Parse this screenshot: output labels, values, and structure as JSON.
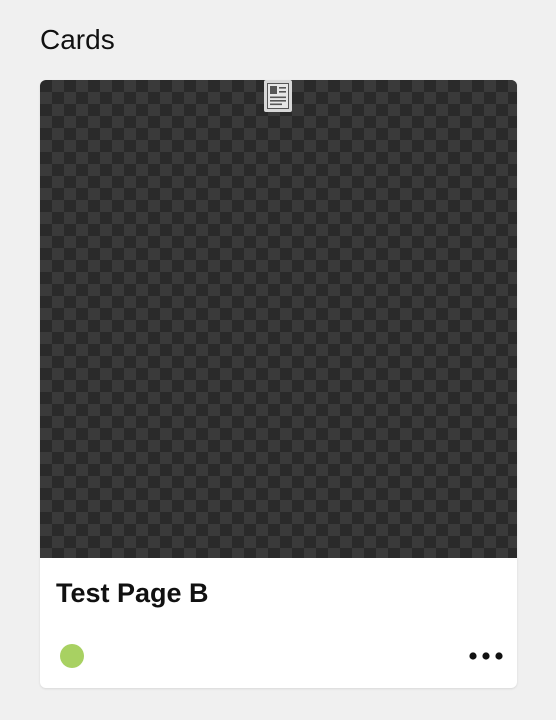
{
  "section": {
    "title": "Cards"
  },
  "card": {
    "title": "Test Page B",
    "preview_icon": "document-page-icon",
    "status_icon": "status-dot-icon",
    "status_color": "#a8d162",
    "menu_icon": "more-horizontal-icon"
  },
  "colors": {
    "background": "#f0f0f0",
    "card": "#ffffff",
    "preview_dark": "#2a2a2a",
    "preview_light": "#3a3a3a"
  }
}
